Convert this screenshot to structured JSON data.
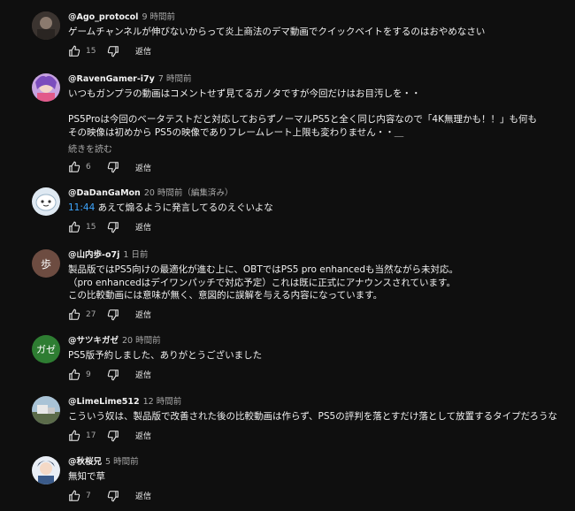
{
  "comments": [
    {
      "author": "@Ago_protocol",
      "time": "9 時間前",
      "lines": [
        "ゲームチャンネルが伸びないからって炎上商法のデマ動画でクイックベイトをするのはおやめなさい"
      ],
      "likes": "15",
      "reply": "返信"
    },
    {
      "author": "@RavenGamer-i7y",
      "time": "7 時間前",
      "lines": [
        "いつもガンプラの動画はコメントせず見てるガノタですが今回だけはお目汚しを・・",
        "",
        "PS5Proは今回のベータテストだと対応しておらずノーマルPS5と全く同じ内容なので「4K無理かも！！」も何も",
        "その映像は初めから PS5の映像でありフレームレート上限も変わりません・・＿"
      ],
      "more": "続きを読む",
      "likes": "6",
      "reply": "返信"
    },
    {
      "author": "@DaDanGaMon",
      "time": "20 時間前（編集済み）",
      "timestamp": "11:44",
      "text_after_timestamp": " あえて煽るように発言してるのえぐいよな",
      "likes": "15",
      "reply": "返信"
    },
    {
      "author": "@山内歩-o7j",
      "time": "1 日前",
      "avatar_char": "歩",
      "lines": [
        "製品版ではPS5向けの最適化が進む上に、OBTではPS5 pro enhancedも当然ながら未対応。",
        "（pro enhancedはデイワンパッチで対応予定）これは既に正式にアナウンスされています。",
        "この比較動画には意味が無く、意図的に誤解を与える内容になっています。"
      ],
      "likes": "27",
      "reply": "返信"
    },
    {
      "author": "@サツキガゼ",
      "time": "20 時間前",
      "avatar_char": "ガゼ",
      "lines": [
        "PS5版予約しました、ありがとうございました"
      ],
      "likes": "9",
      "reply": "返信"
    },
    {
      "author": "@LimeLime512",
      "time": "12 時間前",
      "lines": [
        "こういう奴は、製品版で改善された後の比較動画は作らず、PS5の評判を落とすだけ落として放置するタイプだろうな"
      ],
      "likes": "17",
      "reply": "返信"
    },
    {
      "author": "@秋桜兄",
      "time": "5 時間前",
      "lines": [
        "無知で草"
      ],
      "likes": "7",
      "reply": "返信"
    }
  ],
  "colors": {
    "bg": "#0f0f0f",
    "text": "#f1f1f1",
    "muted": "#aaaaaa",
    "link": "#3ea6ff",
    "avatar_ho": "#6d4c41",
    "avatar_gaze": "#2e7d32"
  },
  "icons": {
    "like": "thumbs-up-icon",
    "dislike": "thumbs-down-icon"
  }
}
